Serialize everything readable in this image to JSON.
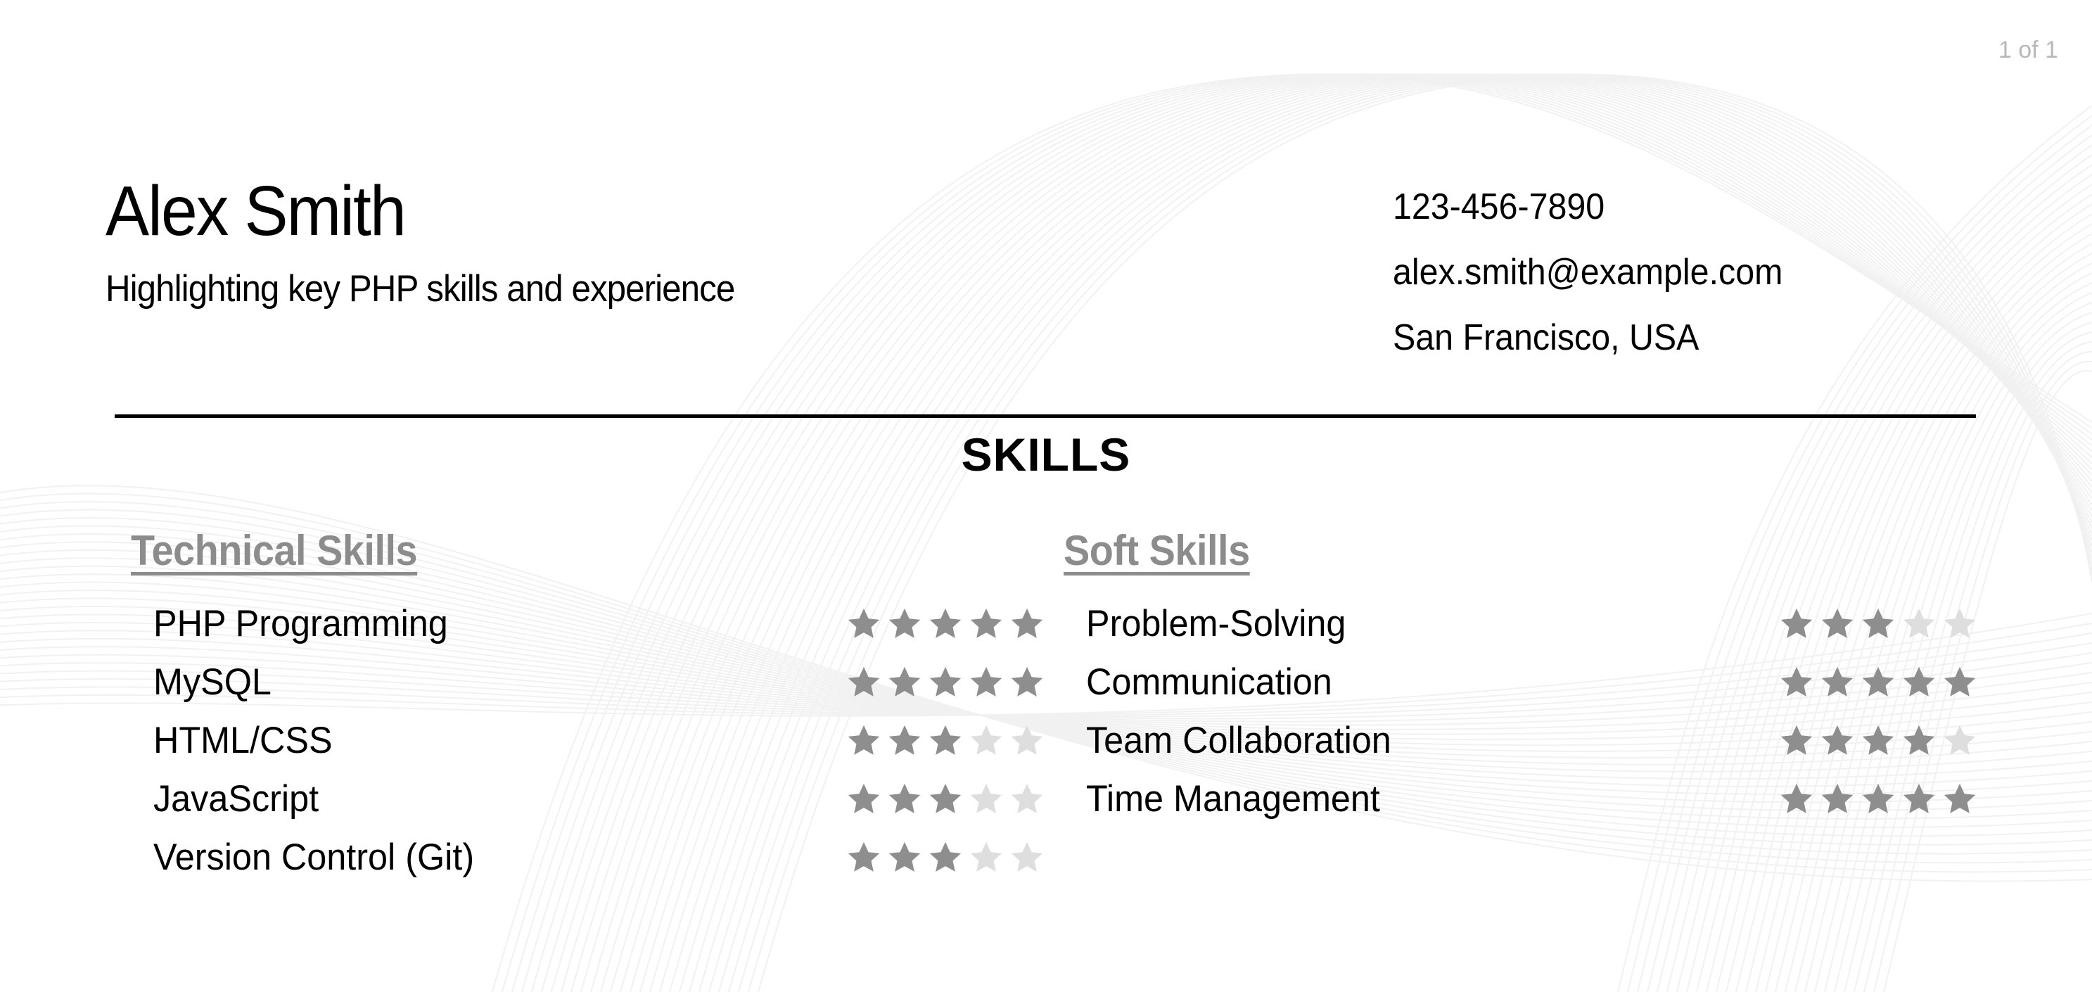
{
  "page_indicator": "1 of 1",
  "header": {
    "name": "Alex Smith",
    "tagline": "Highlighting key PHP skills and experience"
  },
  "contact": {
    "phone": "123-456-7890",
    "email": "alex.smith@example.com",
    "location": "San Francisco, USA"
  },
  "skills": {
    "section_title": "SKILLS",
    "rating_max": 5,
    "colors": {
      "star_filled": "#8e8e8e",
      "star_empty": "#dedede",
      "subheading": "#8c8c8c"
    },
    "technical": {
      "title": "Technical Skills",
      "items": [
        {
          "name": "PHP Programming",
          "rating": 5
        },
        {
          "name": "MySQL",
          "rating": 5
        },
        {
          "name": "HTML/CSS",
          "rating": 3
        },
        {
          "name": "JavaScript",
          "rating": 3
        },
        {
          "name": "Version Control (Git)",
          "rating": 3
        }
      ]
    },
    "soft": {
      "title": "Soft Skills",
      "items": [
        {
          "name": "Problem-Solving",
          "rating": 3
        },
        {
          "name": "Communication",
          "rating": 5
        },
        {
          "name": "Team Collaboration",
          "rating": 4
        },
        {
          "name": "Time Management",
          "rating": 5
        }
      ]
    }
  }
}
